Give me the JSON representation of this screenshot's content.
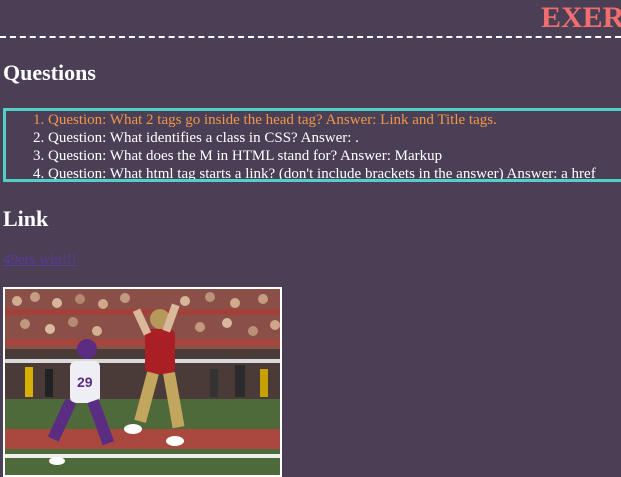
{
  "page": {
    "title": "EXER",
    "questions_heading": "Questions",
    "link_heading": "Link"
  },
  "questions": [
    "Question: What 2 tags go inside the head tag? Answer: Link and Title tags.",
    "Question: What identifies a class in CSS? Answer: .",
    "Question: What does the M in HTML stand for? Answer: Markup",
    "Question: What html tag starts a link? (don't include brackets in the answer) Answer: a href"
  ],
  "link": {
    "text": "49ers win!!!"
  },
  "colors": {
    "background": "#4b3f56",
    "title": "#f06e6e",
    "box_border": "#4fd0c8",
    "first_item": "#f0964a",
    "link": "#5b3a99"
  }
}
